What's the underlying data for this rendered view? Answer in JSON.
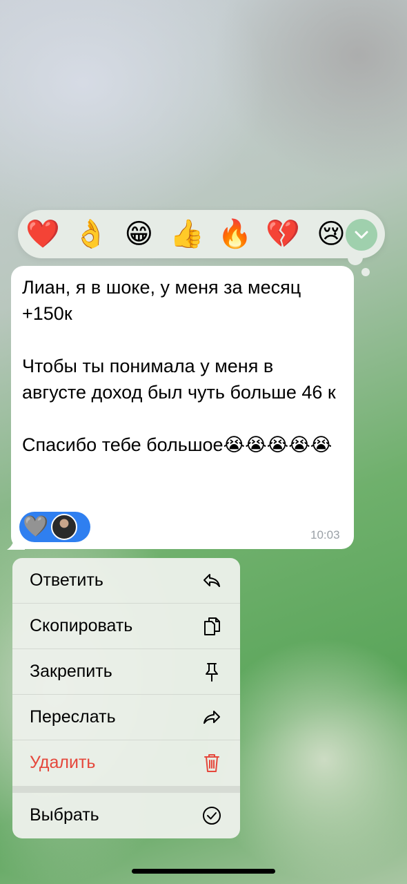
{
  "reactions": {
    "items": [
      "❤️",
      "👌",
      "😁",
      "👍",
      "🔥",
      "💔",
      "😢"
    ],
    "expand_icon": "chevron-down-icon"
  },
  "message": {
    "text": "Лиан, я в шоке, у меня за месяц +150к\n\nЧтобы ты понимала у меня в августе доход был чуть больше 46 к\n\nСпасибо тебе большое😭😭😭😭😭",
    "reaction_emoji": "🩶",
    "time": "10:03"
  },
  "menu": {
    "reply": "Ответить",
    "copy": "Скопировать",
    "pin": "Закрепить",
    "forward": "Переслать",
    "delete": "Удалить",
    "select": "Выбрать"
  },
  "colors": {
    "accent": "#2f7ff0",
    "destructive": "#e5473b",
    "expand_button": "#9fd0ad"
  }
}
